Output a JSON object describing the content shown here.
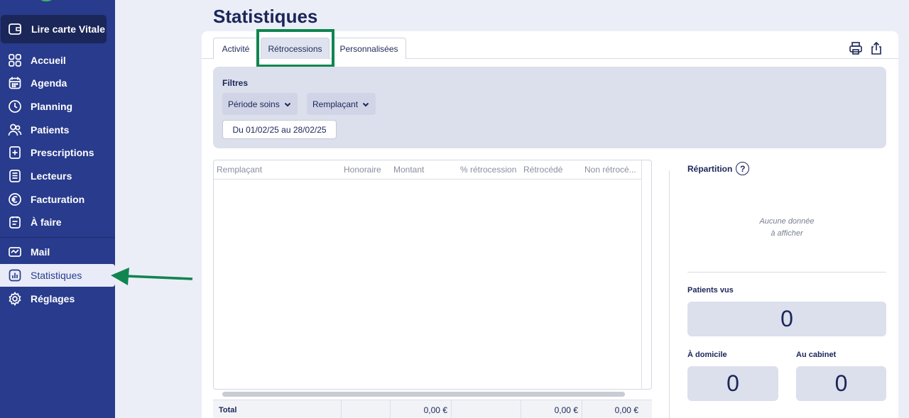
{
  "sidebar": {
    "vitale_label": "Lire carte Vitale",
    "items": [
      {
        "label": "Accueil",
        "icon": "grid-icon"
      },
      {
        "label": "Agenda",
        "icon": "calendar-icon"
      },
      {
        "label": "Planning",
        "icon": "clock-icon"
      },
      {
        "label": "Patients",
        "icon": "users-icon"
      },
      {
        "label": "Prescriptions",
        "icon": "prescription-icon"
      },
      {
        "label": "Lecteurs",
        "icon": "card-reader-icon"
      },
      {
        "label": "Facturation",
        "icon": "euro-icon"
      },
      {
        "label": "À faire",
        "icon": "todo-icon"
      },
      {
        "label": "Mail",
        "icon": "mail-icon"
      },
      {
        "label": "Statistiques",
        "icon": "stats-icon"
      },
      {
        "label": "Réglages",
        "icon": "gear-icon"
      }
    ]
  },
  "page": {
    "title": "Statistiques"
  },
  "tabs": [
    {
      "label": "Activité"
    },
    {
      "label": "Rétrocessions"
    },
    {
      "label": "Personnalisées"
    }
  ],
  "filters": {
    "label": "Filtres",
    "period_select": "Période soins",
    "replacement_select": "Remplaçant",
    "date_range": "Du 01/02/25 au 28/02/25"
  },
  "table": {
    "columns": [
      "Remplaçant",
      "Honoraire",
      "Montant",
      "% rétrocession",
      "Rétrocédé",
      "Non rétrocé..."
    ],
    "total": {
      "label": "Total",
      "honoraire": "",
      "montant": "0,00 €",
      "pct": "",
      "retrocede": "0,00 €",
      "non_retrocede": "0,00 €"
    }
  },
  "panel": {
    "repartition_label": "Répartition",
    "help_symbol": "?",
    "empty_line1": "Aucune donnée",
    "empty_line2": "à afficher",
    "patients_vus_label": "Patients vus",
    "patients_vus_value": "0",
    "domicile_label": "À domicile",
    "domicile_value": "0",
    "cabinet_label": "Au cabinet",
    "cabinet_value": "0"
  },
  "colors": {
    "sidebar": "#283b8c",
    "highlight": "#108550",
    "background": "#eceef7"
  }
}
